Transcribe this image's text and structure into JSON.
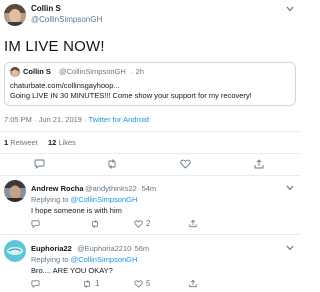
{
  "main": {
    "author_name": "Collin S",
    "author_handle": "@CollinSimpsonGH",
    "tweet_text": "IM LIVE NOW!",
    "quote": {
      "name": "Collin S",
      "handle": "@CollinSimpsonGH",
      "age": "· 2h",
      "line1": "chaturbate.com/collinsgayhoop...",
      "line2": "Going LIVE IN 30 MINUTES!!! Come show your support for my recovery!"
    },
    "timestamp": "7:05 PM · Jun 21, 2019 · ",
    "client": "Twitter for Android",
    "retweet_count": "1",
    "retweet_label": "Retweet",
    "likes_count": "12",
    "likes_label": "Likes"
  },
  "replies": [
    {
      "name": "Andrew Rocha",
      "handle": "@andythinks22",
      "age": "· 54m",
      "replying_prefix": "Replying to ",
      "replying_handle": "@CollinSimpsonGH",
      "text": "I hope someone is with him",
      "reply_count": "",
      "retweet_count": "",
      "like_count": "2"
    },
    {
      "name": "Euphoria22",
      "handle": "@Euphoria2210",
      "age": "· 56m",
      "replying_prefix": "Replying to ",
      "replying_handle": "@CollinSimpsonGH",
      "text": "Bro.... ARE YOU OKAY?",
      "reply_count": "",
      "retweet_count": "1",
      "like_count": "5"
    }
  ],
  "icons": [
    "comment-icon",
    "retweet-icon",
    "heart-icon",
    "share-icon"
  ],
  "colors": {
    "link": "#1b95e0",
    "muted": "#657786",
    "divider": "#e6ecf0",
    "text": "#14171a"
  }
}
